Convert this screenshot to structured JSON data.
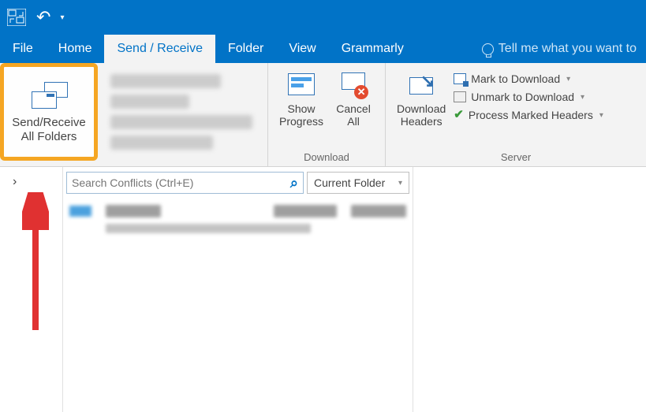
{
  "tabs": {
    "file": "File",
    "home": "Home",
    "sendreceive": "Send / Receive",
    "folder": "Folder",
    "view": "View",
    "grammarly": "Grammarly",
    "tellme": "Tell me what you want to"
  },
  "ribbon": {
    "send_receive_all": {
      "line1": "Send/Receive",
      "line2": "All Folders"
    },
    "download_group": "Download",
    "show_progress": {
      "line1": "Show",
      "line2": "Progress"
    },
    "cancel_all": {
      "line1": "Cancel",
      "line2": "All"
    },
    "download_headers": {
      "line1": "Download",
      "line2": "Headers"
    },
    "server_group": "Server",
    "mark_to_download": "Mark to Download",
    "unmark_to_download": "Unmark to Download",
    "process_marked": "Process Marked Headers"
  },
  "search": {
    "placeholder": "Search Conflicts (Ctrl+E)",
    "scope": "Current Folder"
  }
}
